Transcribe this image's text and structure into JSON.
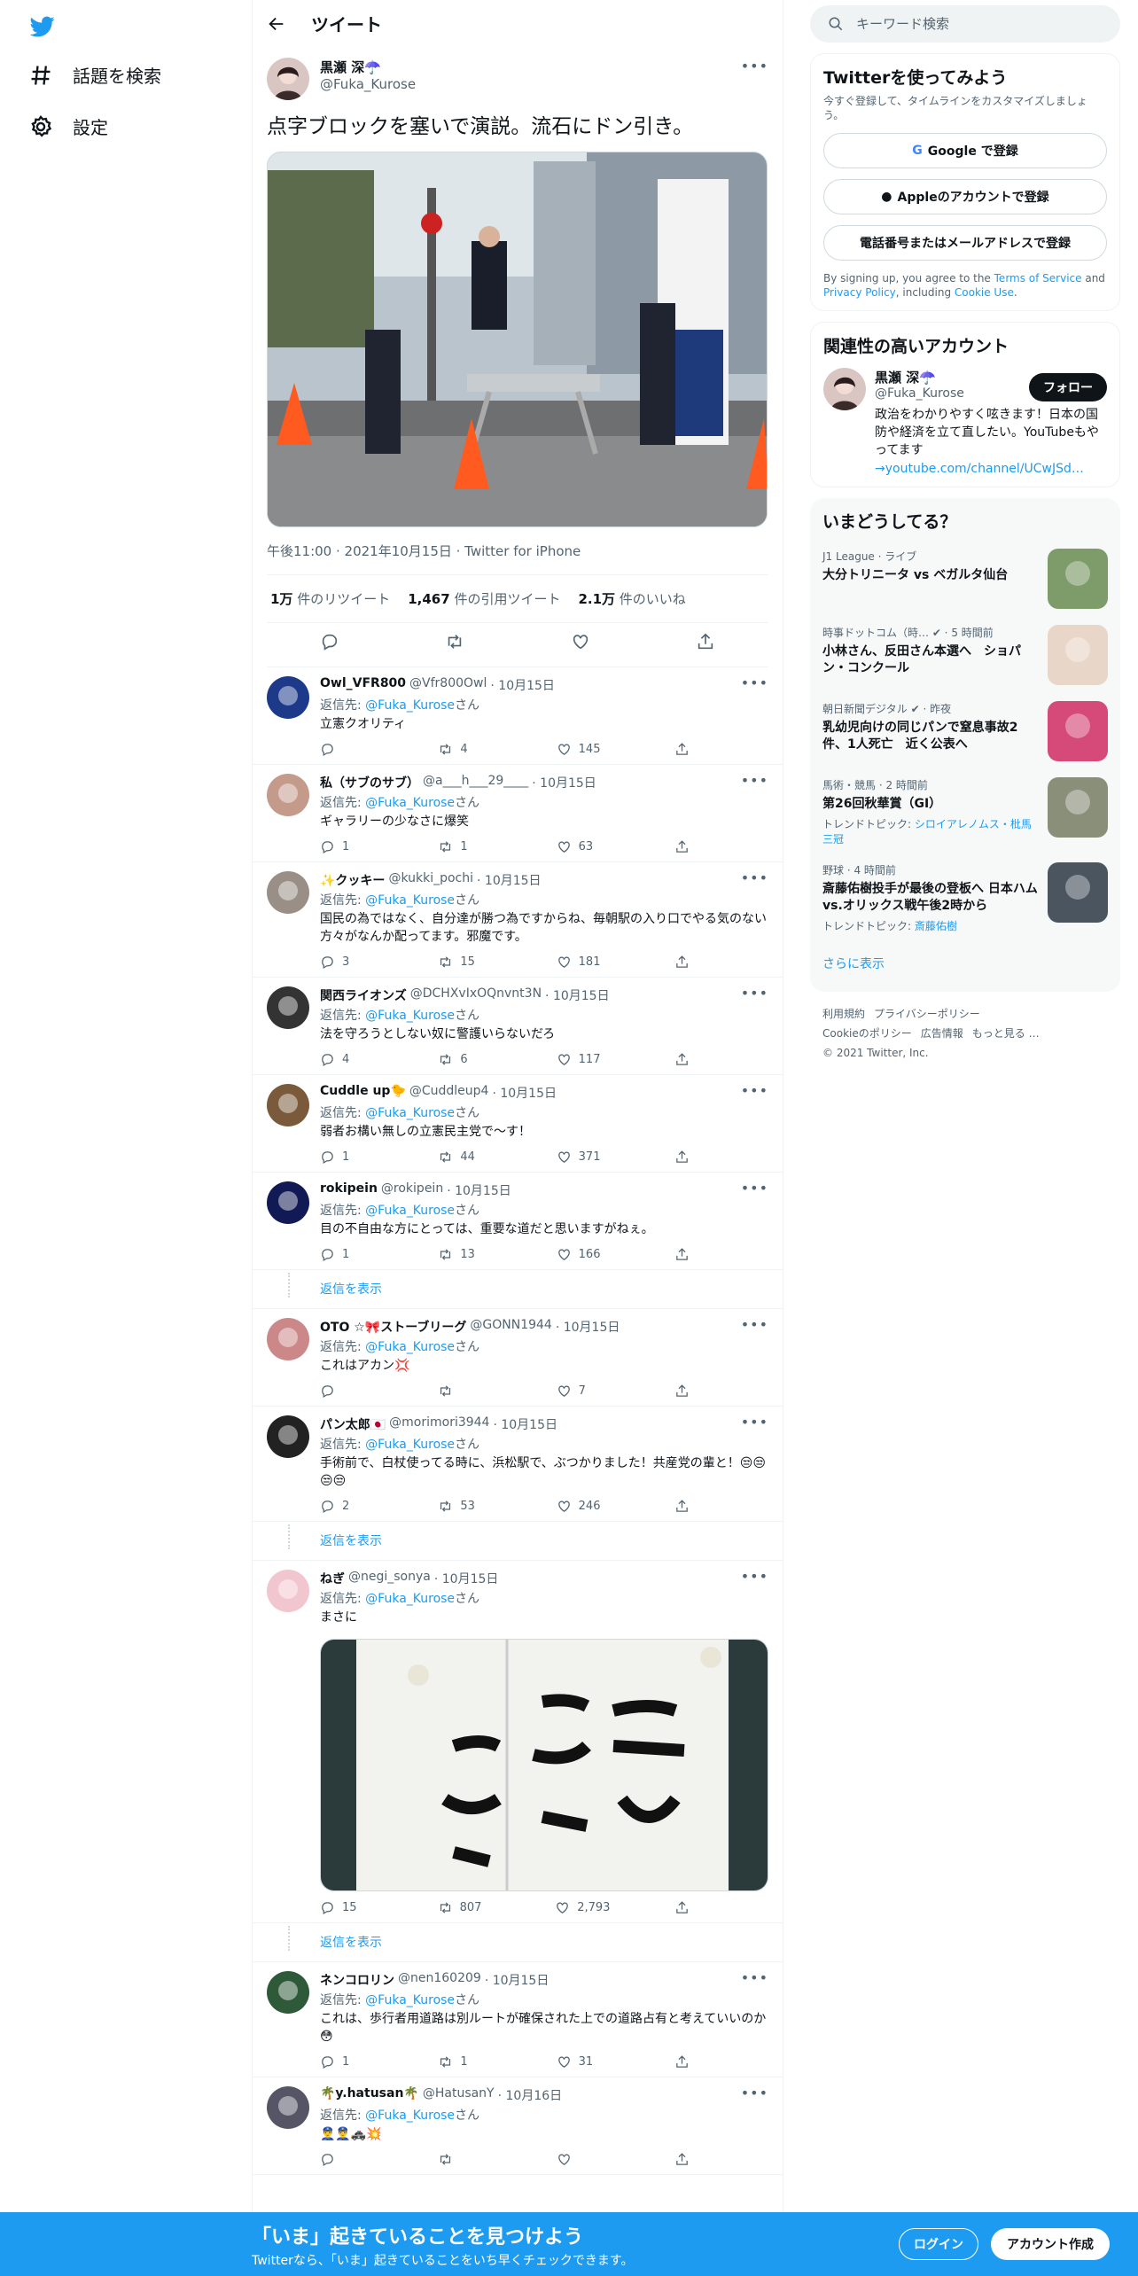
{
  "nav": {
    "explore": "話題を検索",
    "settings": "設定"
  },
  "header": {
    "title": "ツイート"
  },
  "main_tweet": {
    "name": "黒瀬 深☂️",
    "handle": "@Fuka_Kurose",
    "text": "点字ブロックを塞いで演説。流石にドン引き。",
    "meta": "午後11:00 · 2021年10月15日 · Twitter for iPhone",
    "retweets_num": "1万",
    "retweets_label": " 件のリツイート",
    "quotes_num": "1,467",
    "quotes_label": " 件の引用ツイート",
    "likes_num": "2.1万",
    "likes_label": " 件のいいね"
  },
  "replying_label": "返信先: ",
  "san": "さん",
  "replies": [
    {
      "name": "Owl_VFR800",
      "handle": "@Vfr800Owl",
      "date": "· 10月15日",
      "to": "@Fuka_Kurose",
      "text": "立憲クオリティ",
      "replies": "",
      "retweets": "4",
      "likes": "145"
    },
    {
      "name": "私（サブのサブ）",
      "handle": "@a___h___29____",
      "date": "· 10月15日",
      "to": "@Fuka_Kurose",
      "text": "ギャラリーの少なさに爆笑",
      "replies": "1",
      "retweets": "1",
      "likes": "63"
    },
    {
      "name": "✨クッキー",
      "handle": "@kukki_pochi",
      "date": "· 10月15日",
      "to": "@Fuka_Kurose",
      "text": "国民の為ではなく、自分達が勝つ為ですからね、毎朝駅の入り口でやる気のない方々がなんか配ってます。邪魔です。",
      "replies": "3",
      "retweets": "15",
      "likes": "181"
    },
    {
      "name": "関西ライオンズ",
      "handle": "@DCHXvIxOQnvnt3N",
      "date": "· 10月15日",
      "to": "@Fuka_Kurose",
      "text": "法を守ろうとしない奴に警護いらないだろ",
      "replies": "4",
      "retweets": "6",
      "likes": "117"
    },
    {
      "name": "Cuddle up🐤",
      "handle": "@Cuddleup4",
      "date": "· 10月15日",
      "to": "@Fuka_Kurose",
      "text": "弱者お構い無しの立憲民主党で〜す！",
      "replies": "1",
      "retweets": "44",
      "likes": "371"
    },
    {
      "name": "rokipein",
      "handle": "@rokipein",
      "date": "· 10月15日",
      "to": "@Fuka_Kurose",
      "text": "目の不自由な方にとっては、重要な道だと思いますがねぇ。",
      "replies": "1",
      "retweets": "13",
      "likes": "166",
      "show_replies": true
    },
    {
      "name": "OTO ☆🎀ストーブリーグ",
      "handle": "@GONN1944",
      "date": "· 10月15日",
      "to": "@Fuka_Kurose",
      "text": "これはアカン💢",
      "replies": "",
      "retweets": "",
      "likes": "7"
    },
    {
      "name": "パン太郎🇯🇵",
      "handle": "@morimori3944",
      "date": "· 10月15日",
      "to": "@Fuka_Kurose",
      "text": "手術前で、白杖使ってる時に、浜松駅で、ぶつかりました！共産党の輩と！😒😒😒😒",
      "replies": "2",
      "retweets": "53",
      "likes": "246",
      "show_replies": true
    },
    {
      "name": "ねぎ",
      "handle": "@negi_sonya",
      "date": "· 10月15日",
      "to": "@Fuka_Kurose",
      "text": "まさに",
      "replies": "15",
      "retweets": "807",
      "likes": "2,793",
      "image": true,
      "show_replies": true
    },
    {
      "name": "ネンコロリン",
      "handle": "@nen160209",
      "date": "· 10月15日",
      "to": "@Fuka_Kurose",
      "text": "これは、歩行者用道路は別ルートが確保された上での道路占有と考えていいのか😳",
      "replies": "1",
      "retweets": "1",
      "likes": "31"
    },
    {
      "name": "🌴y.hatusan🌴",
      "handle": "@HatusanY",
      "date": "· 10月16日",
      "to": "@Fuka_Kurose",
      "text": "👮‍♂️👮‍♂️🚓💥",
      "replies": "",
      "retweets": "",
      "likes": ""
    }
  ],
  "show_replies_label": "返信を表示",
  "search": {
    "placeholder": "キーワード検索"
  },
  "signup_box": {
    "title": "Twitterを使ってみよう",
    "sub": "今すぐ登録して、タイムラインをカスタマイズしましょう。",
    "google": "Google で登録",
    "apple": "Appleのアカウントで登録",
    "phone": "電話番号またはメールアドレスで登録",
    "legal1": "By signing up, you agree to the ",
    "terms": "Terms of Service",
    "legal2": " and ",
    "privacy": "Privacy Policy",
    "legal3": ", including ",
    "cookie": "Cookie Use",
    "legal4": "."
  },
  "related": {
    "title": "関連性の高いアカウント",
    "name": "黒瀬 深☂️",
    "handle": "@Fuka_Kurose",
    "follow": "フォロー",
    "bio": "政治をわかりやすく呟きます！日本の国防や経済を立て直したい。YouTubeもやってます",
    "link": "→youtube.com/channel/UCwJSd…"
  },
  "trends": {
    "title": "いまどうしてる？",
    "items": [
      {
        "meta": "J1 League · ライブ",
        "title": "大分トリニータ vs ベガルタ仙台",
        "sub": ""
      },
      {
        "meta": "時事ドットコム（時… ✔ · 5 時間前",
        "title": "小林さん、反田さん本選へ　ショパン・コンクール",
        "sub": ""
      },
      {
        "meta": "朝日新聞デジタル ✔ · 昨夜",
        "title": "乳幼児向けの同じパンで窒息事故2件、1人死亡　近く公表へ",
        "sub": ""
      },
      {
        "meta": "馬術・競馬 · 2 時間前",
        "title": "第26回秋華賞（GⅠ）",
        "sub_label": "トレンドトピック: ",
        "sub": "シロイアレノムス・枇馬三冠"
      },
      {
        "meta": "野球 · 4 時間前",
        "title": "斎藤佑樹投手が最後の登板へ 日本ハムvs.オリックス戦午後2時から",
        "sub_label": "トレンドトピック: ",
        "sub": "斎藤佑樹"
      }
    ],
    "show_more": "さらに表示"
  },
  "footer": {
    "terms": "利用規約",
    "privacy": "プライバシーポリシー",
    "cookie": "Cookieのポリシー",
    "ads": "広告情報",
    "more": "もっと見る …",
    "copyright": "© 2021 Twitter, Inc."
  },
  "bottombar": {
    "title": "「いま」起きていることを見つけよう",
    "sub": "Twitterなら、「いま」起きていることをいち早くチェックできます。",
    "login": "ログイン",
    "signup": "アカウント作成"
  },
  "colors": {
    "accent": "#1d9bf0",
    "text": "#0f1419",
    "muted": "#536471"
  }
}
